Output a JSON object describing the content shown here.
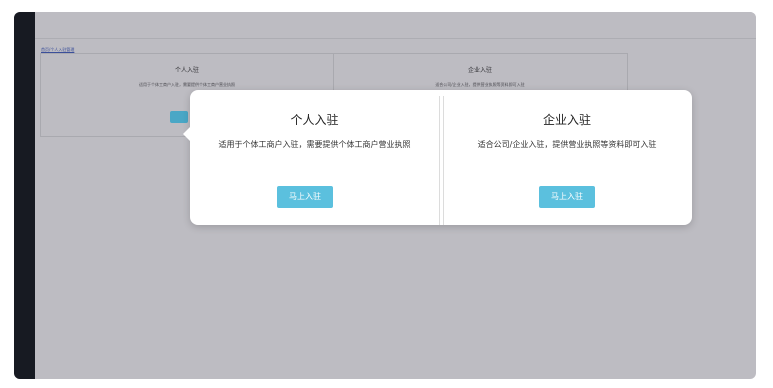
{
  "background": {
    "breadcrumb_link": "首页/个人入驻管理",
    "personal": {
      "title": "个人入驻",
      "description": "适用于个体工商户入驻，需要提供个体工商户营业执照"
    },
    "enterprise": {
      "title": "企业入驻",
      "description": "适合公司/企业入驻，提供营业执照等资料即可入驻"
    }
  },
  "popover": {
    "personal": {
      "title": "个人入驻",
      "description": "适用于个体工商户入驻，需要提供个体工商户营业执照",
      "button_label": "马上入驻"
    },
    "enterprise": {
      "title": "企业入驻",
      "description": "适合公司/企业入驻，提供营业执照等资料即可入驻",
      "button_label": "马上入驻"
    }
  },
  "colors": {
    "overlay_bg": "#bdbcc2",
    "sidebar": "#171a22",
    "accent_button": "#5bc0de"
  }
}
